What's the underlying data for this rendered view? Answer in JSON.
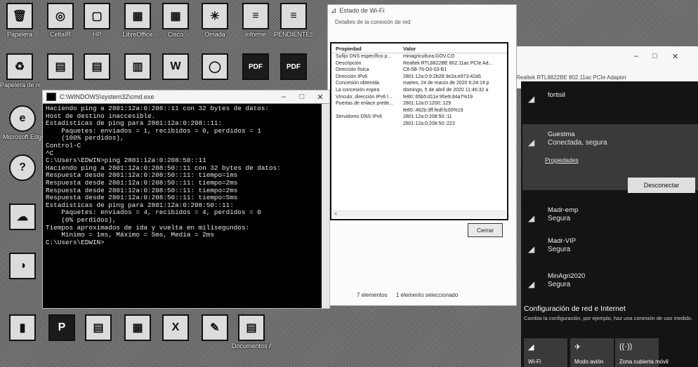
{
  "desktop_icons": [
    {
      "label": "Papelera",
      "glyph": "🗑",
      "icon": "recycle-bin-icon"
    },
    {
      "label": "CeltaIR",
      "glyph": "◎",
      "icon": "app-icon"
    },
    {
      "label": "HP",
      "glyph": "▢",
      "icon": "printer-icon"
    },
    {
      "label": "LibreOffice",
      "glyph": "▦",
      "icon": "office-icon"
    },
    {
      "label": "Cisco",
      "glyph": "▦",
      "icon": "network-icon"
    },
    {
      "label": "Omada",
      "glyph": "✳",
      "icon": "omada-icon"
    },
    {
      "label": "informe",
      "glyph": "≡",
      "icon": "document-icon"
    },
    {
      "label": "PENDIENTES MARZO",
      "glyph": "≡",
      "icon": "document-icon"
    },
    {
      "label": "Papelera de reciclaje",
      "glyph": "♻",
      "icon": "recycle-bin-icon"
    },
    {
      "label": "",
      "glyph": "▤",
      "icon": "folder-icon"
    },
    {
      "label": "",
      "glyph": "▤",
      "icon": "scanner-icon"
    },
    {
      "label": "",
      "glyph": "▥",
      "icon": "chart-icon"
    },
    {
      "label": "",
      "glyph": "W",
      "icon": "word-icon"
    },
    {
      "label": "",
      "glyph": "◯",
      "icon": "media-icon"
    },
    {
      "label": "",
      "glyph": "PDF",
      "icon": "pdf-icon"
    },
    {
      "label": "",
      "glyph": "PDF",
      "icon": "pdf-icon"
    },
    {
      "label": "Microsoft Edge",
      "glyph": "e",
      "icon": "edge-icon"
    },
    {
      "label": "",
      "glyph": "?",
      "icon": "help-icon"
    },
    {
      "label": "",
      "glyph": "☁",
      "icon": "cloud-icon"
    },
    {
      "label": "",
      "glyph": "◑",
      "icon": "app-icon"
    },
    {
      "label": "",
      "glyph": "▮",
      "icon": "app-icon"
    },
    {
      "label": "",
      "glyph": "P",
      "icon": "publisher-icon"
    },
    {
      "label": "",
      "glyph": "▤",
      "icon": "shortcut-icon"
    },
    {
      "label": "",
      "glyph": "▦",
      "icon": "shortcut-icon"
    },
    {
      "label": "",
      "glyph": "X",
      "icon": "excel-icon"
    },
    {
      "label": "",
      "glyph": "✎",
      "icon": "shortcut-icon"
    },
    {
      "label": "Documentos Accesorios",
      "glyph": "▤",
      "icon": "folder-icon"
    }
  ],
  "cmd": {
    "title": "C:\\WINDOWS\\system32\\cmd.exe",
    "lines": [
      "Haciendo ping a 2801:12a:0:208::11 con 32 bytes de datos:",
      "Host de destino inaccesible.",
      "",
      "Estadísticas de ping para 2801:12a:0:208::11:",
      "    Paquetes: enviados = 1, recibidos = 0, perdidos = 1",
      "    (100% perdidos),",
      "Control-C",
      "^C",
      "C:\\Users\\EDWIN>ping 2801:12a:0:208:50::11",
      "",
      "Haciendo ping a 2801:12a:0:208:50::11 con 32 bytes de datos:",
      "Respuesta desde 2801:12a:0:208:50::11: tiempo=1ms",
      "Respuesta desde 2801:12a:0:208:50::11: tiempo=2ms",
      "Respuesta desde 2801:12a:0:208:50::11: tiempo=2ms",
      "Respuesta desde 2801:12a:0:208:50::11: tiempo=5ms",
      "",
      "Estadísticas de ping para 2801:12a:0:208:50::11:",
      "    Paquetes: enviados = 4, recibidos = 4, perdidos = 0",
      "    (0% perdidos),",
      "Tiempos aproximados de ida y vuelta en milisegundos:",
      "    Mínimo = 1ms, Máximo = 5ms, Media = 2ms",
      "",
      "C:\\Users\\EDWIN>"
    ]
  },
  "status_window": {
    "title": "Estado de Wi-Fi",
    "subtitle": "Detalles de la conexión de red",
    "columns": [
      "Propiedad",
      "Valor"
    ],
    "rows": [
      [
        "Sufijo DNS específico p...",
        "minagricultura.GOV.CO"
      ],
      [
        "Descripción",
        "Realtek RTL8822BE 802.11ac PCIe Ad..."
      ],
      [
        "Dirección física",
        "C8-5B-76-D0-03-B1"
      ],
      [
        "Dirección IPv6",
        "2801:12a:0:9:2b28:3e2a:e973:42a5"
      ],
      [
        "Concesión obtenida",
        "martes, 24 de marzo de 2020 6:24:19 p"
      ],
      [
        "La concesión expira",
        "domingo, 5 de abril de 2020 11:46:32 a"
      ],
      [
        "Vínculo: dirección IPv6 l...",
        "fe80::65b5:d11e:95e9:d4a7%19"
      ],
      [
        "Puertas de enlace prede...",
        "2801:12a:0:1200::129"
      ],
      [
        "",
        "fe80::462b:3ff:fedf:fc00%19"
      ],
      [
        "Servidores DNS IPv6",
        "2801:12a:0:208:50::11"
      ],
      [
        "",
        "2801:12a:0:208:50::222"
      ]
    ],
    "close_label": "Cerrar",
    "items_count": "7 elementos",
    "selected_count": "1 elemento seleccionado"
  },
  "explorer_peek": {
    "minimize": "–",
    "maximize": "□",
    "close": "✕",
    "text": "Realtek RTL8822BE 802.11ac PCIe Adapter"
  },
  "wifi": {
    "networks": [
      {
        "name": "fortisil",
        "status": ""
      },
      {
        "name": "Guestma",
        "status": "Conectada, segura"
      },
      {
        "name": "Madr-emp",
        "status": "Segura"
      },
      {
        "name": "Madr-VIP",
        "status": "Segura"
      },
      {
        "name": "MinAgri2020",
        "status": "Segura"
      }
    ],
    "properties_link": "Propiedades",
    "disconnect_label": "Desconectar",
    "settings_title": "Configuración de red e Internet",
    "settings_desc": "Cambia la configuración, por ejemplo, haz una conexión de uso medido.",
    "quick_actions": [
      {
        "label": "Wi-Fi",
        "icon": "wifi-icon",
        "glyph": "◢"
      },
      {
        "label": "Modo avión",
        "icon": "airplane-icon",
        "glyph": "✈"
      },
      {
        "label": "Zona cubierta móvil",
        "icon": "hotspot-icon",
        "glyph": "((·))"
      }
    ]
  }
}
